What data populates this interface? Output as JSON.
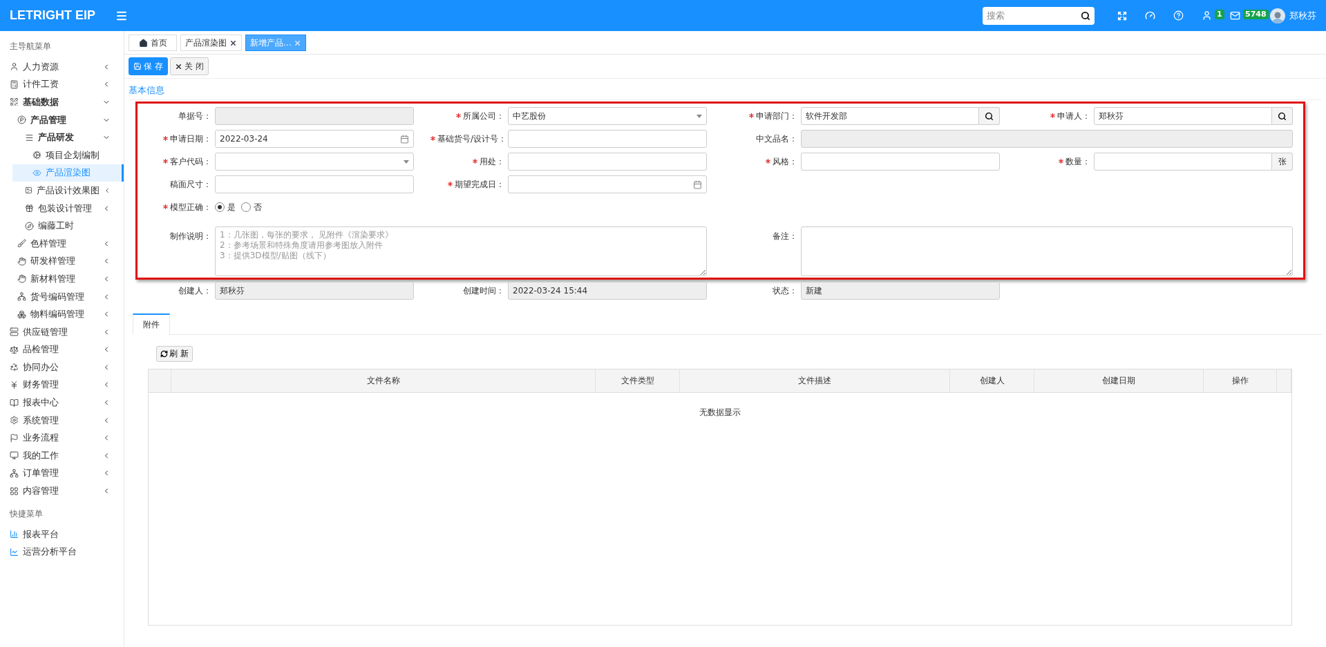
{
  "header": {
    "logo": "LETRIGHT EIP",
    "search": {
      "placeholder": "搜索"
    },
    "badges": [
      {
        "kind": "user",
        "count": "1"
      },
      {
        "kind": "mail",
        "count": "5748"
      }
    ],
    "user_name": "郑秋芬"
  },
  "sidebar": {
    "section_title": "主导航菜单",
    "items": [
      {
        "label": "人力资源",
        "expanded": false
      },
      {
        "label": "计件工资",
        "expanded": false
      },
      {
        "label": "基础数据",
        "expanded": true,
        "children": [
          {
            "label": "产品管理",
            "expanded": true,
            "children": [
              {
                "label": "产品研发",
                "expanded": true,
                "children": [
                  {
                    "label": "项目企划编制",
                    "selected": false
                  },
                  {
                    "label": "产品渲染图",
                    "selected": true
                  }
                ]
              },
              {
                "label": "产品设计效果图",
                "expanded": false
              },
              {
                "label": "包装设计管理",
                "expanded": false
              },
              {
                "label": "编藤工时"
              }
            ]
          },
          {
            "label": "色样管理",
            "expanded": false
          },
          {
            "label": "研发样管理",
            "expanded": false
          },
          {
            "label": "新材料管理",
            "expanded": false
          },
          {
            "label": "货号编码管理",
            "expanded": false
          },
          {
            "label": "物料编码管理",
            "expanded": false
          }
        ]
      },
      {
        "label": "供应链管理",
        "expanded": false
      },
      {
        "label": "品检管理",
        "expanded": false
      },
      {
        "label": "协同办公",
        "expanded": false
      },
      {
        "label": "财务管理",
        "expanded": false
      },
      {
        "label": "报表中心",
        "expanded": false
      },
      {
        "label": "系统管理",
        "expanded": false
      },
      {
        "label": "业务流程",
        "expanded": false
      },
      {
        "label": "我的工作",
        "expanded": false
      },
      {
        "label": "订单管理",
        "expanded": false
      },
      {
        "label": "内容管理",
        "expanded": false
      }
    ],
    "shortcut_title": "快捷菜单",
    "shortcuts": [
      "报表平台",
      "运营分析平台"
    ]
  },
  "page_tabs": [
    {
      "label": "首页",
      "kind": "home",
      "selected": false
    },
    {
      "label": "产品渲染图",
      "kind": "closable",
      "selected": false
    },
    {
      "label": "新增产品...",
      "kind": "closable",
      "selected": true
    }
  ],
  "toolbar": [
    {
      "label": "保 存",
      "kind": "save"
    },
    {
      "label": "关 闭",
      "kind": "close"
    }
  ],
  "form": {
    "section_title": "基本信息",
    "rows": [
      [
        {
          "label": "单据号：",
          "kind": "text",
          "required": false,
          "disabled": true
        },
        {
          "label": "所属公司：",
          "kind": "select",
          "required": true,
          "disabled": false,
          "value": "中艺股份"
        },
        {
          "label": "申请部门：",
          "kind": "lookup",
          "required": true,
          "disabled": false,
          "value": "软件开发部"
        },
        {
          "label": "申请人：",
          "kind": "lookup",
          "required": true,
          "disabled": false,
          "value": "郑秋芬"
        }
      ],
      [
        {
          "label": "申请日期：",
          "kind": "date",
          "required": true,
          "disabled": false,
          "value": "2022-03-24"
        },
        {
          "label": "基础货号/设计号：",
          "kind": "text",
          "required": true,
          "disabled": false
        },
        {
          "label": "中文品名：",
          "kind": "wide",
          "required": false,
          "disabled": true
        },
        ""
      ],
      [
        {
          "label": "客户代码：",
          "kind": "select",
          "required": true,
          "disabled": false
        },
        {
          "label": "用处：",
          "kind": "text",
          "required": true,
          "disabled": false
        },
        {
          "label": "风格：",
          "kind": "text",
          "required": true,
          "disabled": false
        },
        {
          "label": "数量：",
          "kind": "unit",
          "required": true,
          "disabled": false,
          "unit": "张"
        }
      ],
      [
        {
          "label": "稿面尺寸：",
          "kind": "text",
          "required": false,
          "disabled": false
        },
        {
          "label": "期望完成日：",
          "kind": "date",
          "required": true,
          "disabled": false
        }
      ],
      [
        {
          "label": "模型正确：",
          "kind": "radio",
          "required": true,
          "disabled": false,
          "options": [
            {
              "label": "是",
              "selected": true
            },
            {
              "label": "否",
              "selected": false
            }
          ]
        }
      ],
      [
        {
          "label": "制作说明：",
          "kind": "textarea",
          "required": false,
          "disabled": false,
          "placeholder": "1：几张图，每张的要求， 见附件《渲染要求》\n2：参考场景和特殊角度请用参考图放入附件\n3：提供3D模型/贴图（线下）"
        },
        "",
        {
          "label": "备注：",
          "kind": "textarea",
          "required": false,
          "disabled": false
        },
        ""
      ]
    ],
    "meta_row": [
      {
        "label": "创建人：",
        "kind": "text",
        "required": false,
        "disabled": true,
        "value": "郑秋芬"
      },
      {
        "label": "创建时间：",
        "kind": "text",
        "required": false,
        "disabled": true,
        "value": "2022-03-24 15:44"
      },
      {
        "label": "状态：",
        "kind": "text",
        "required": false,
        "disabled": true,
        "value": "新建"
      }
    ]
  },
  "attachments": {
    "tabs": [
      {
        "label": "附件",
        "selected": true
      }
    ],
    "refresh_label": "刷 新",
    "columns": [
      "文件名称",
      "文件类型",
      "文件描述",
      "创建人",
      "创建日期",
      "操作"
    ],
    "empty_text": "无数据显示"
  }
}
